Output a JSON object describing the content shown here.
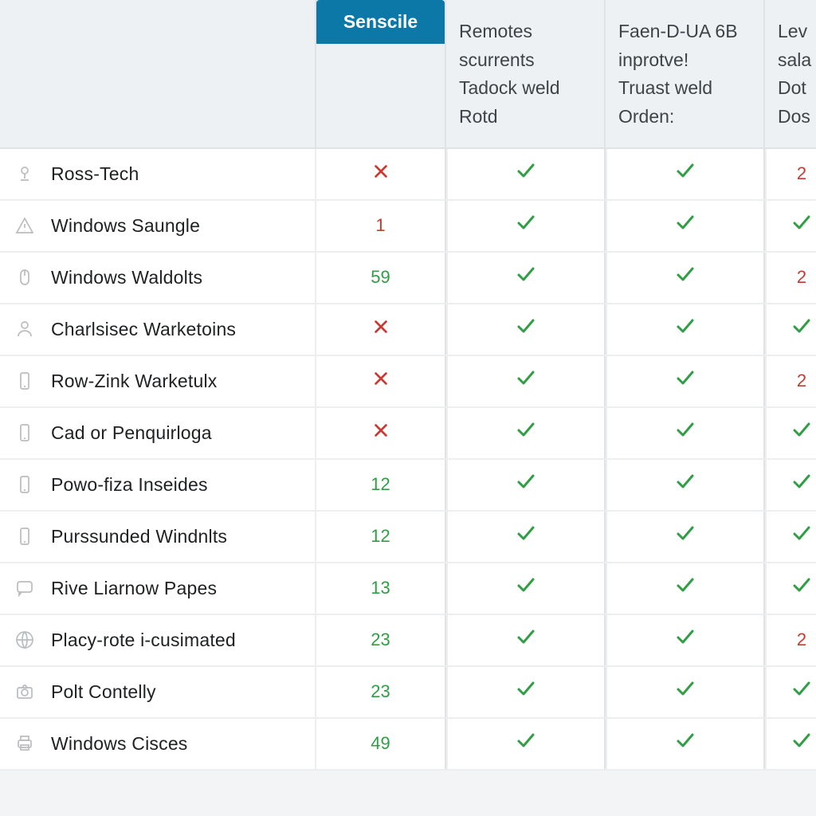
{
  "columns": {
    "name": "",
    "a": "Senscile",
    "b": "Remotes\nscurrents\nTadock weld\nRotd",
    "c": "Faen-D-UA 6B\ninprotve!\nTruast weld\nOrden:",
    "d": "Lev\nsala\nDot\nDos"
  },
  "rows": [
    {
      "icon": "pin",
      "label": "Ross-Tech",
      "a": {
        "kind": "x"
      },
      "b": {
        "kind": "check"
      },
      "c": {
        "kind": "check"
      },
      "d": {
        "kind": "num",
        "value": "2",
        "color": "red"
      }
    },
    {
      "icon": "warn",
      "label": "Windows Saungle",
      "a": {
        "kind": "num",
        "value": "1",
        "color": "red"
      },
      "b": {
        "kind": "check"
      },
      "c": {
        "kind": "check"
      },
      "d": {
        "kind": "check"
      }
    },
    {
      "icon": "mouse",
      "label": "Windows Waldolts",
      "a": {
        "kind": "num",
        "value": "59",
        "color": "green"
      },
      "b": {
        "kind": "check"
      },
      "c": {
        "kind": "check"
      },
      "d": {
        "kind": "num",
        "value": "2",
        "color": "red"
      }
    },
    {
      "icon": "person",
      "label": "Charlsisec Warketoins",
      "a": {
        "kind": "x"
      },
      "b": {
        "kind": "check"
      },
      "c": {
        "kind": "check"
      },
      "d": {
        "kind": "check"
      }
    },
    {
      "icon": "phone",
      "label": "Row-Zink Warketulx",
      "a": {
        "kind": "x"
      },
      "b": {
        "kind": "check"
      },
      "c": {
        "kind": "check"
      },
      "d": {
        "kind": "num",
        "value": "2",
        "color": "red"
      }
    },
    {
      "icon": "phone",
      "label": "Cad or Penquirloga",
      "a": {
        "kind": "x"
      },
      "b": {
        "kind": "check"
      },
      "c": {
        "kind": "check"
      },
      "d": {
        "kind": "check"
      }
    },
    {
      "icon": "phone",
      "label": "Powo-fiza Inseides",
      "a": {
        "kind": "num",
        "value": "12",
        "color": "green"
      },
      "b": {
        "kind": "check"
      },
      "c": {
        "kind": "check"
      },
      "d": {
        "kind": "check"
      }
    },
    {
      "icon": "phone",
      "label": "Purssunded Windnlts",
      "a": {
        "kind": "num",
        "value": "12",
        "color": "green"
      },
      "b": {
        "kind": "check"
      },
      "c": {
        "kind": "check"
      },
      "d": {
        "kind": "check"
      }
    },
    {
      "icon": "chat",
      "label": "Rive Liarnow Papes",
      "a": {
        "kind": "num",
        "value": "13",
        "color": "green"
      },
      "b": {
        "kind": "check"
      },
      "c": {
        "kind": "check"
      },
      "d": {
        "kind": "check"
      }
    },
    {
      "icon": "globe",
      "label": "Placy-rote i-cusimated",
      "a": {
        "kind": "num",
        "value": "23",
        "color": "green"
      },
      "b": {
        "kind": "check"
      },
      "c": {
        "kind": "check"
      },
      "d": {
        "kind": "num",
        "value": "2",
        "color": "red"
      }
    },
    {
      "icon": "camera",
      "label": "Polt Contelly",
      "a": {
        "kind": "num",
        "value": "23",
        "color": "green"
      },
      "b": {
        "kind": "check"
      },
      "c": {
        "kind": "check"
      },
      "d": {
        "kind": "check"
      }
    },
    {
      "icon": "printer",
      "label": "Windows Cisces",
      "a": {
        "kind": "num",
        "value": "49",
        "color": "green"
      },
      "b": {
        "kind": "check"
      },
      "c": {
        "kind": "check"
      },
      "d": {
        "kind": "check"
      }
    }
  ]
}
